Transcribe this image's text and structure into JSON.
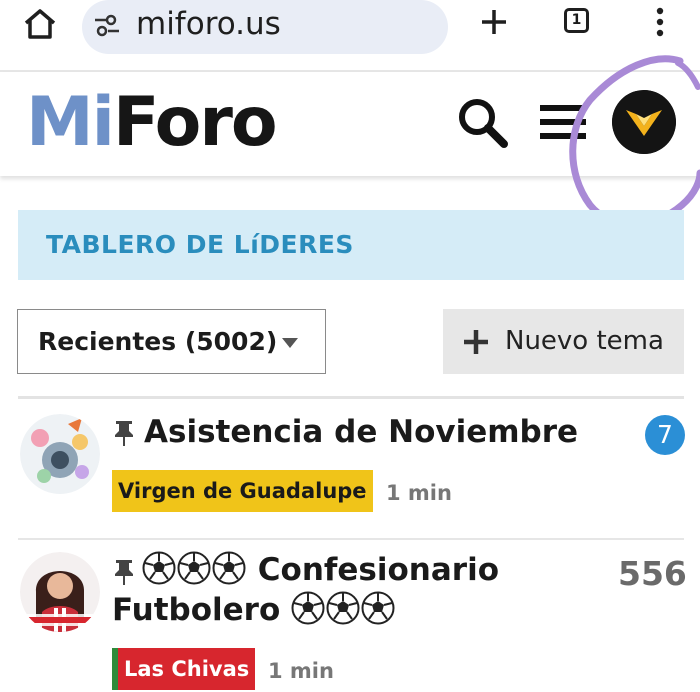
{
  "browser": {
    "url": "miforo.us",
    "tab_count": "1",
    "icons": [
      "home-icon",
      "site-settings-icon",
      "plus-icon",
      "tabs-icon",
      "more-vertical-icon"
    ]
  },
  "site": {
    "logo_mi": "Mi",
    "logo_foro": "Foro",
    "colors": {
      "logo_mi": "#6e91c8",
      "banner_bg": "#d5ecf7",
      "banner_text": "#2a8dbd",
      "annotation": "#a98ad6"
    }
  },
  "banner": {
    "title": "TABLERO DE LíDERES"
  },
  "filter": {
    "selected": "Recientes (5002)"
  },
  "new_topic": {
    "label": "Nuevo tema"
  },
  "topics": [
    {
      "title": "Asistencia de Noviembre",
      "category": "Virgen de Guadalupe",
      "category_bg": "#f0c419",
      "category_color": "#1a1a1a",
      "age": "1 min",
      "unread": "7",
      "pinned": true
    },
    {
      "title_line1": "Confesionario",
      "title_line2": "Futbolero",
      "category": "Las Chivas",
      "category_bg": "#d7262e",
      "category_color": "#ffffff",
      "age": "1 min",
      "replies": "556",
      "pinned": true
    }
  ]
}
